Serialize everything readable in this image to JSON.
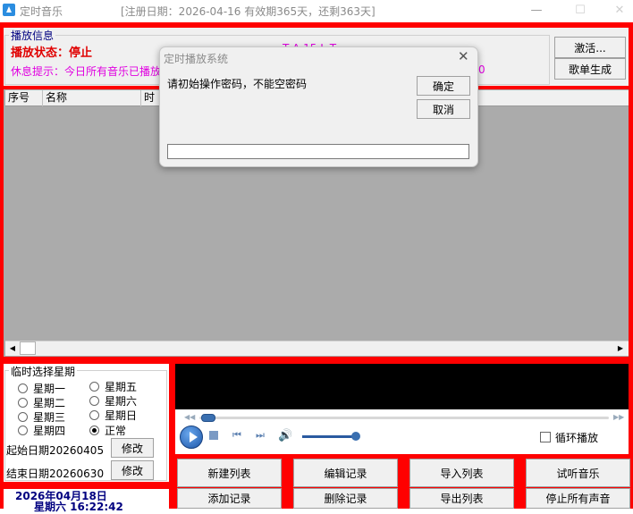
{
  "window": {
    "title": "定时音乐",
    "registration": "[注册日期：2026-04-16   有效期365天，还剩363天]",
    "minimize": "—",
    "maximize": "☐",
    "close": "✕"
  },
  "info": {
    "legend": "播放信息",
    "status": "播放状态：停止",
    "tip": "休息提示：今日所有音乐已播放",
    "center_clip": "T     A 15 L  T",
    "right_clip": "0",
    "activate_label": "激活...",
    "songlist_label": "歌单生成"
  },
  "list": {
    "columns": [
      "序号",
      "名称",
      "时"
    ]
  },
  "week": {
    "legend": "临时选择星期",
    "options": [
      {
        "label": "星期一",
        "checked": false
      },
      {
        "label": "星期二",
        "checked": false
      },
      {
        "label": "星期三",
        "checked": false
      },
      {
        "label": "星期四",
        "checked": false
      },
      {
        "label": "星期五",
        "checked": false
      },
      {
        "label": "星期六",
        "checked": false
      },
      {
        "label": "星期日",
        "checked": false
      },
      {
        "label": "正常",
        "checked": true
      }
    ],
    "start_date": "起始日期20260405",
    "end_date": "结束日期20260630",
    "modify_label": "修改"
  },
  "clock": {
    "date": "2026年04月18日",
    "time": "星期六   16:22:42"
  },
  "player": {
    "loop_label": "循环播放",
    "loop_checked": false,
    "icons": [
      "play-icon",
      "stop-icon",
      "previous-icon",
      "next-icon",
      "volume-icon"
    ]
  },
  "buttons": {
    "new_list": "新建列表",
    "edit_record": "编辑记录",
    "import_list": "导入列表",
    "preview_music": "试听音乐",
    "add_record": "添加记录",
    "delete_record": "删除记录",
    "export_list": "导出列表",
    "stop_all": "停止所有声音"
  },
  "dialog": {
    "title": "定时播放系统",
    "message": "请初始操作密码，不能空密码",
    "ok_label": "确定",
    "cancel_label": "取消",
    "input_value": ""
  },
  "colors": {
    "frame_red": "#ff0000",
    "status_red": "#e00000",
    "tip_magenta": "#e000e0",
    "clock_navy": "#000080"
  }
}
